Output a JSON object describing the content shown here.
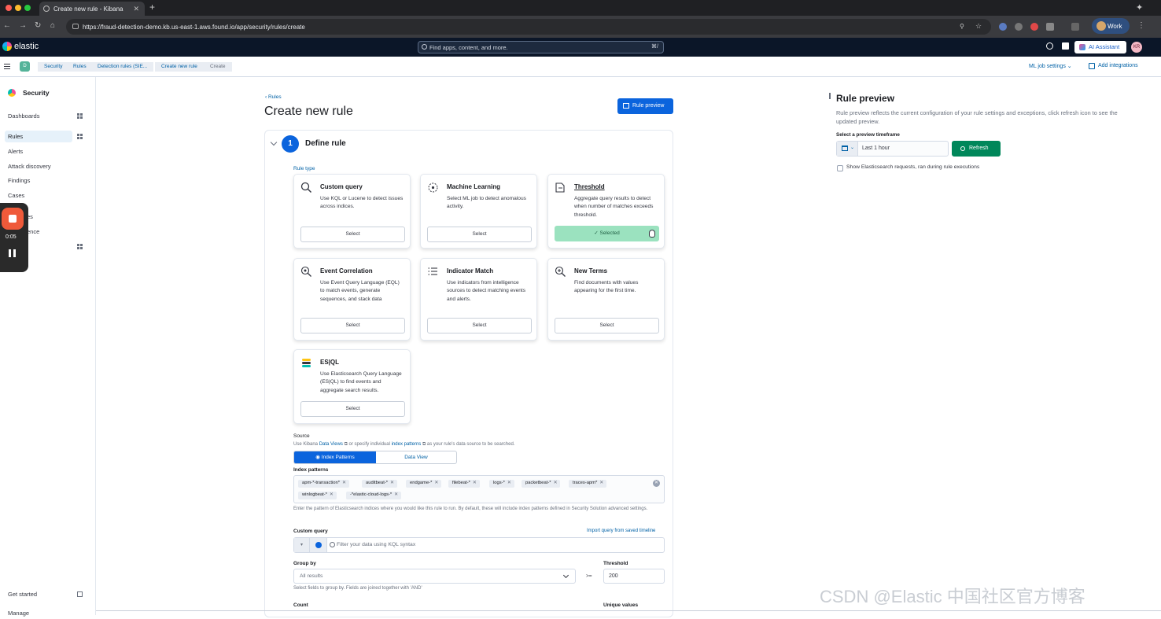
{
  "browser": {
    "tab_title": "Create new rule - Kibana",
    "url": "https://fraud-detection-demo.kb.us-east-1.aws.found.io/app/security/rules/create",
    "profile": "Work"
  },
  "kibana_header": {
    "logo": "elastic",
    "search_placeholder": "Find apps, content, and more.",
    "search_shortcut": "⌘/",
    "ai_assistant": "AI Assistant",
    "avatar_initials": "KR"
  },
  "breadcrumbs": {
    "space_initial": "D",
    "items": [
      "Security",
      "Rules",
      "Detection rules (SIE...",
      "Create new rule",
      "Create"
    ],
    "ml_job_settings": "ML job settings",
    "add_integrations": "Add integrations"
  },
  "sidebar": {
    "title": "Security",
    "items": [
      {
        "label": "Dashboards"
      },
      {
        "label": "Rules"
      },
      {
        "label": "Alerts"
      },
      {
        "label": "Attack discovery"
      },
      {
        "label": "Findings"
      },
      {
        "label": "Cases"
      },
      {
        "label": "es"
      },
      {
        "label": "ence"
      }
    ],
    "get_started": "Get started",
    "manage": "Manage"
  },
  "recorder": {
    "time": "0:05"
  },
  "main": {
    "back_link": "Rules",
    "page_title": "Create new rule",
    "rule_preview_button": "Rule preview",
    "step_number": "1",
    "step_title": "Define rule",
    "rule_type_label": "Rule type",
    "rule_types": [
      {
        "title": "Custom query",
        "desc": "Use KQL or Lucene to detect issues across indices.",
        "button": "Select",
        "icon": "search-icon"
      },
      {
        "title": "Machine Learning",
        "desc": "Select ML job to detect anomalous activity.",
        "button": "Select",
        "icon": "ml-icon"
      },
      {
        "title": "Threshold",
        "desc": "Aggregate query results to detect when number of matches exceeds threshold.",
        "button": "Selected",
        "icon": "threshold-icon"
      },
      {
        "title": "Event Correlation",
        "desc": "Use Event Query Language (EQL) to match events, generate sequences, and stack data",
        "button": "Select",
        "icon": "eql-icon"
      },
      {
        "title": "Indicator Match",
        "desc": "Use indicators from intelligence sources to detect matching events and alerts.",
        "button": "Select",
        "icon": "list-icon"
      },
      {
        "title": "New Terms",
        "desc": "Find documents with values appearing for the first time.",
        "button": "Select",
        "icon": "zoom-plus-icon"
      },
      {
        "title": "ES|QL",
        "desc": "Use Elasticsearch Query Language (ES|QL) to find events and aggregate search results.",
        "button": "Select",
        "icon": "esql-icon"
      }
    ],
    "source": {
      "label": "Source",
      "help_1": "Use Kibana ",
      "help_link_1": "Data Views",
      "help_2": " or specify individual ",
      "help_link_2": "index patterns",
      "help_3": " as your rule's data source to be searched.",
      "toggle_a": "Index Patterns",
      "toggle_b": "Data View"
    },
    "index_patterns": {
      "label": "Index patterns",
      "chips": [
        "apm-*-transaction*",
        "auditbeat-*",
        "endgame-*",
        "filebeat-*",
        "logs-*",
        "packetbeat-*",
        "traces-apm*",
        "winlogbeat-*",
        "-*elastic-cloud-logs-*"
      ],
      "help": "Enter the pattern of Elasticsearch indices where you would like this rule to run. By default, these will include index patterns defined in Security Solution advanced settings."
    },
    "custom_query": {
      "label": "Custom query",
      "import_link": "Import query from saved timeline",
      "placeholder": "Filter your data using KQL syntax"
    },
    "group_by": {
      "label": "Group by",
      "value": "All results",
      "help": "Select fields to group by. Fields are joined together with 'AND'"
    },
    "threshold": {
      "label": "Threshold",
      "operator": ">=",
      "value": "200"
    },
    "count_label": "Count",
    "unique_values_label": "Unique values"
  },
  "rule_preview": {
    "title": "Rule preview",
    "desc": "Rule preview reflects the current configuration of your rule settings and exceptions, click refresh icon to see the updated preview.",
    "timeframe_label": "Select a preview timeframe",
    "timeframe_value": "Last 1 hour",
    "refresh_button": "Refresh",
    "checkbox_label": "Show Elasticsearch requests, ran during rule executions"
  },
  "watermark": "CSDN @Elastic 中国社区官方博客"
}
